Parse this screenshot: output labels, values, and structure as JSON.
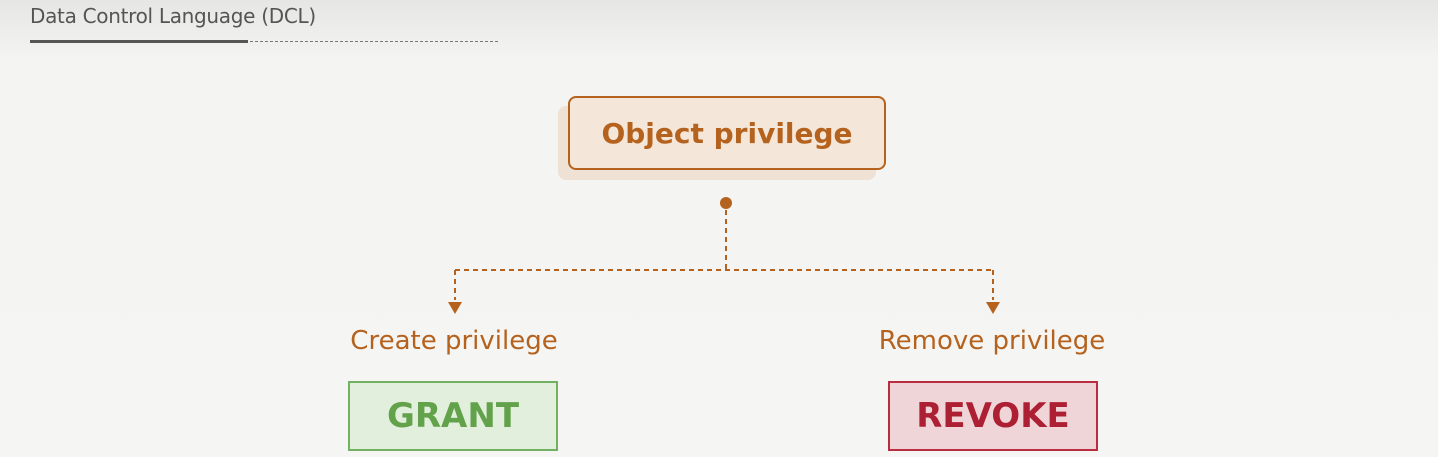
{
  "header": {
    "title": "Data Control Language (DCL)"
  },
  "diagram": {
    "root": "Object privilege",
    "left": {
      "label": "Create privilege",
      "command": "GRANT"
    },
    "right": {
      "label": "Remove privilege",
      "command": "REVOKE"
    }
  },
  "colors": {
    "accent": "#b5621e",
    "grant": "#62a24a",
    "revoke": "#ad1f33"
  }
}
